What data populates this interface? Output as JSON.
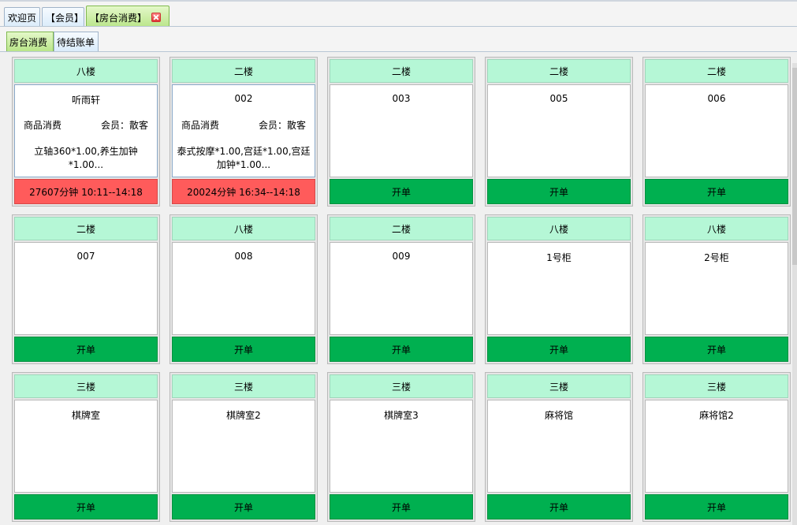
{
  "tabs": [
    {
      "label": "欢迎页",
      "active": false
    },
    {
      "label": "【会员】",
      "active": false
    },
    {
      "label": "【房台消费】",
      "active": true
    }
  ],
  "subtabs": [
    {
      "label": "房台消费",
      "active": true
    },
    {
      "label": "待结账单",
      "active": false
    }
  ],
  "colors": {
    "floor_header": "#b5f7d6",
    "open_button": "#00b050",
    "busy_footer": "#ff5b5b",
    "active_tab": "#b7e486"
  },
  "rooms": [
    {
      "floor": "八楼",
      "name": "听雨轩",
      "type": "商品消费",
      "member": "会员：散客",
      "items": "立轴360*1.00,养生加钟*1.00...",
      "footer": "27607分钟  10:11--14:18",
      "busy": true
    },
    {
      "floor": "二楼",
      "name": "002",
      "type": "商品消费",
      "member": "会员：散客",
      "items": "泰式按摩*1.00,宫廷*1.00,宫廷加钟*1.00...",
      "footer": "20024分钟  16:34--14:18",
      "busy": true
    },
    {
      "floor": "二楼",
      "name": "003",
      "footer": "开单",
      "busy": false
    },
    {
      "floor": "二楼",
      "name": "005",
      "footer": "开单",
      "busy": false
    },
    {
      "floor": "二楼",
      "name": "006",
      "footer": "开单",
      "busy": false
    },
    {
      "floor": "二楼",
      "name": "007",
      "footer": "开单",
      "busy": false
    },
    {
      "floor": "八楼",
      "name": "008",
      "footer": "开单",
      "busy": false
    },
    {
      "floor": "二楼",
      "name": "009",
      "footer": "开单",
      "busy": false
    },
    {
      "floor": "八楼",
      "name": "1号柜",
      "footer": "开单",
      "busy": false
    },
    {
      "floor": "八楼",
      "name": "2号柜",
      "footer": "开单",
      "busy": false
    },
    {
      "floor": "三楼",
      "name": "棋牌室",
      "footer": "开单",
      "busy": false
    },
    {
      "floor": "三楼",
      "name": "棋牌室2",
      "footer": "开单",
      "busy": false
    },
    {
      "floor": "三楼",
      "name": "棋牌室3",
      "footer": "开单",
      "busy": false
    },
    {
      "floor": "三楼",
      "name": "麻将馆",
      "footer": "开单",
      "busy": false
    },
    {
      "floor": "三楼",
      "name": "麻将馆2",
      "footer": "开单",
      "busy": false
    }
  ]
}
